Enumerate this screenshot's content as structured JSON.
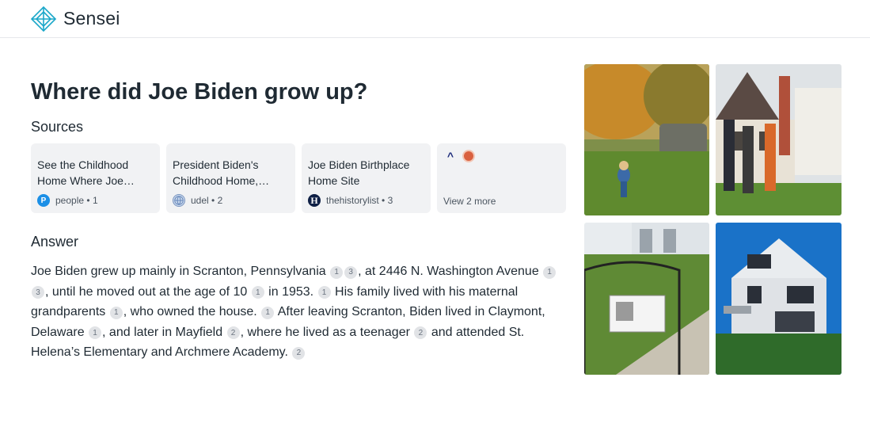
{
  "app": {
    "name": "Sensei"
  },
  "query": {
    "title": "Where did Joe Biden grow up?"
  },
  "sources": {
    "heading": "Sources",
    "cards": [
      {
        "title": "See the Childhood Home Where Joe…",
        "site": "people",
        "sep": "•",
        "index": "1"
      },
      {
        "title": "President Biden's Childhood Home,…",
        "site": "udel",
        "sep": "•",
        "index": "2"
      },
      {
        "title": "Joe Biden Birthplace Home Site",
        "site": "thehistorylist",
        "sep": "•",
        "index": "3"
      }
    ],
    "more": {
      "label": "View 2 more",
      "caret_icon": "^"
    }
  },
  "answer": {
    "heading": "Answer",
    "segments": [
      {
        "text": "Joe Biden grew up mainly in Scranton, Pennsylvania "
      },
      {
        "cite": "1"
      },
      {
        "cite": "3"
      },
      {
        "text": ", at 2446 N. Washington Avenue "
      },
      {
        "cite": "1"
      },
      {
        "cite": "3"
      },
      {
        "text": ", until he moved out at the age of 10 "
      },
      {
        "cite": "1"
      },
      {
        "text": " in 1953. "
      },
      {
        "cite": "1"
      },
      {
        "text": " His family lived with his maternal grandparents "
      },
      {
        "cite": "1"
      },
      {
        "text": ", who owned the house. "
      },
      {
        "cite": "1"
      },
      {
        "text": " After leaving Scranton, Biden lived in Claymont, Delaware "
      },
      {
        "cite": "1"
      },
      {
        "text": ", and later in Mayfield "
      },
      {
        "cite": "2"
      },
      {
        "text": ", where he lived as a teenager "
      },
      {
        "cite": "2"
      },
      {
        "text": " and attended St. Helena’s Elementary and Archmere Academy. "
      },
      {
        "cite": "2"
      }
    ]
  },
  "images": [
    {
      "name": "child-on-lawn-image"
    },
    {
      "name": "family-at-house-image"
    },
    {
      "name": "plaque-and-steps-image"
    },
    {
      "name": "blue-sky-house-image"
    }
  ],
  "colors": {
    "accent": "#1aa7c9",
    "card_bg": "#f1f2f4",
    "cite_bg": "#e1e3e6"
  }
}
